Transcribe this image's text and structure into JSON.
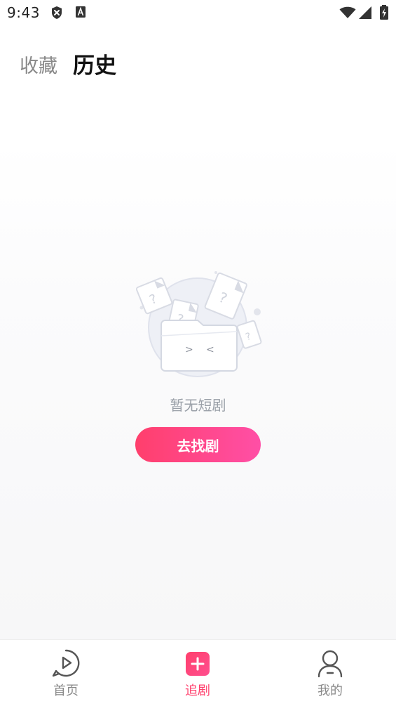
{
  "status_bar": {
    "time": "9:43",
    "icons": [
      "shield-x-icon",
      "font-a-icon",
      "wifi-icon",
      "signal-icon",
      "battery-charging-icon"
    ]
  },
  "header": {
    "tabs": [
      {
        "label": "收藏",
        "active": false
      },
      {
        "label": "历史",
        "active": true
      }
    ]
  },
  "empty_state": {
    "illustration": "empty-folder-icon",
    "message": "暂无短剧",
    "button_label": "去找剧"
  },
  "bottom_nav": {
    "items": [
      {
        "label": "首页",
        "icon": "play-circle-icon",
        "active": false
      },
      {
        "label": "追剧",
        "icon": "plus-square-icon",
        "active": true
      },
      {
        "label": "我的",
        "icon": "user-icon",
        "active": false
      }
    ]
  },
  "colors": {
    "accent": "#ff3f6c",
    "accent_end": "#ff4fa6",
    "muted_text": "#9aa0a8"
  }
}
